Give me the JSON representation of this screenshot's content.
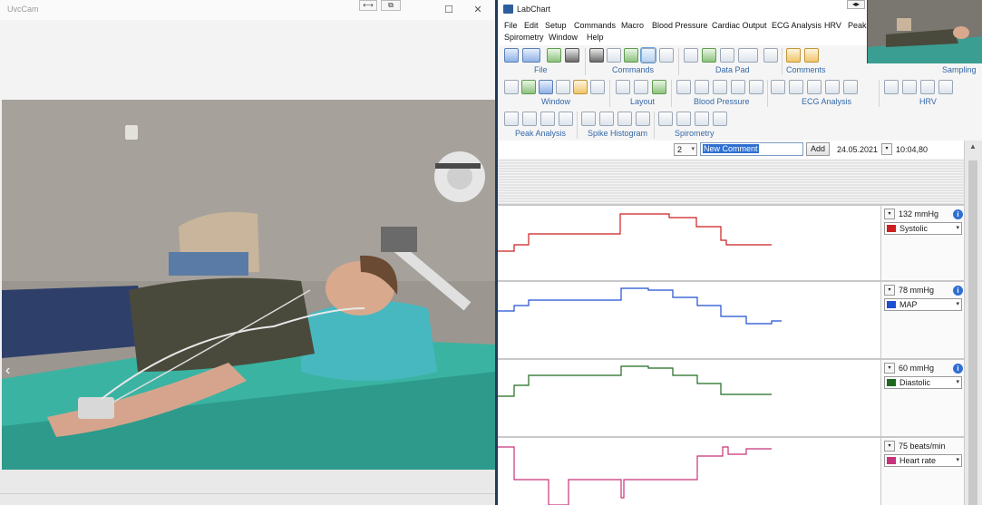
{
  "camera_window": {
    "title": "UvcCam",
    "title_buttons": {
      "resize": "⟷",
      "restore": "⧉",
      "minimize": "",
      "maximize": "☐",
      "close": "✕"
    },
    "nav_arrow": "‹"
  },
  "labchart": {
    "title": "LabChart",
    "title_arrows": "◂▸",
    "menu": [
      "File",
      "Edit",
      "Setup",
      "Commands",
      "Macro",
      "Blood Pressure",
      "Cardiac Output",
      "ECG Analysis",
      "HRV",
      "Peak A",
      "Spirometry",
      "Window",
      "Help"
    ],
    "ribbon_groups": {
      "file": "File",
      "commands": "Commands",
      "data_pad": "Data Pad",
      "comments": "Comments",
      "sampling": "Sampling",
      "window": "Window",
      "layout": "Layout",
      "blood_pressure": "Blood Pressure",
      "ecg_analysis": "ECG Analysis",
      "hrv": "HRV",
      "peak_analysis": "Peak Analysis",
      "spike_histogram": "Spike Histogram",
      "spirometry": "Spirometry"
    },
    "comment_bar": {
      "channel": "2",
      "comment_text": "New Comment",
      "add_label": "Add",
      "date": "24.05.2021",
      "time": "10:04,80"
    },
    "channels": [
      {
        "value": "132 mmHg",
        "name": "Systolic",
        "color": "#cc1f1f",
        "info": "i"
      },
      {
        "value": "78 mmHg",
        "name": "MAP",
        "color": "#1f4fd1",
        "info": "i"
      },
      {
        "value": "60 mmHg",
        "name": "Diastolic",
        "color": "#1f6a1f",
        "info": "i"
      },
      {
        "value": "75 beats/min",
        "name": "Heart rate",
        "color": "#c7337a",
        "info": "i"
      }
    ],
    "dropdown_glyph": "▾"
  }
}
